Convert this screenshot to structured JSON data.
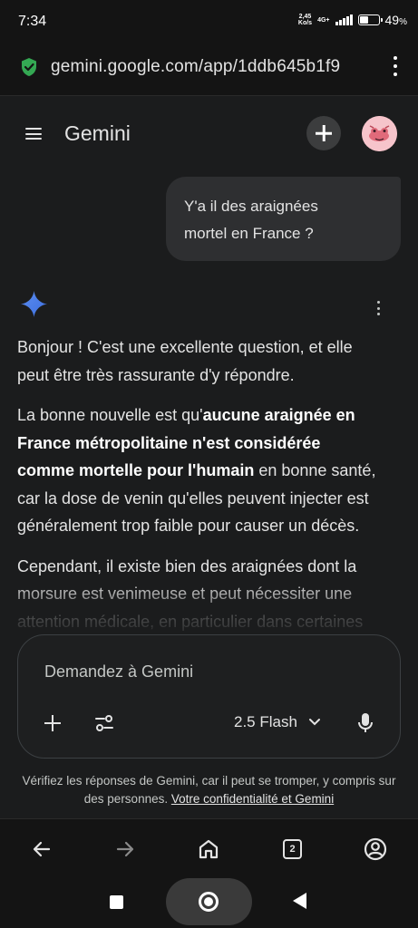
{
  "status_bar": {
    "time": "7:34",
    "net_speed_value": "2,45",
    "net_speed_unit": "Ko/s",
    "network_type": "4G+",
    "battery_percent": "49",
    "battery_level": 0.49
  },
  "browser": {
    "url": "gemini.google.com/app/1ddb645b1f9",
    "tab_count": "2"
  },
  "app": {
    "title": "Gemini"
  },
  "conversation": {
    "user_message_line1": "Y'a il des araignées",
    "user_message_line2": "mortel en France ?",
    "response": {
      "p1": "Bonjour ! C'est une excellente question, et elle peut être très rassurante d'y répondre.",
      "p2_before": "La bonne nouvelle est qu'",
      "p2_bold": "aucune araignée en France métropolitaine n'est considérée comme mortelle pour l'humain",
      "p2_after": " en bonne santé, car la dose de venin qu'elles peuvent injecter est généralement trop faible pour causer un décès.",
      "p3": "Cependant, il existe bien des araignées dont la morsure est venimeuse et peut nécessiter une attention médicale, en particulier dans certaines"
    }
  },
  "input": {
    "placeholder": "Demandez à Gemini",
    "model": "2.5 Flash"
  },
  "disclaimer": {
    "text": "Vérifiez les réponses de Gemini, car il peut se tromper, y compris sur des personnes. ",
    "link": "Votre confidentialité et Gemini"
  },
  "colors": {
    "background": "#1b1c1d",
    "bubble": "#2e2f31",
    "shield": "#34a853",
    "gemini_star": "#4285f4"
  },
  "icons": [
    "shield-icon",
    "more-vert-icon",
    "menu-icon",
    "plus-icon",
    "avatar",
    "gemini-star-icon",
    "tools-icon",
    "chevron-down-icon",
    "mic-icon",
    "back-arrow-icon",
    "forward-arrow-icon",
    "home-icon",
    "account-icon"
  ]
}
